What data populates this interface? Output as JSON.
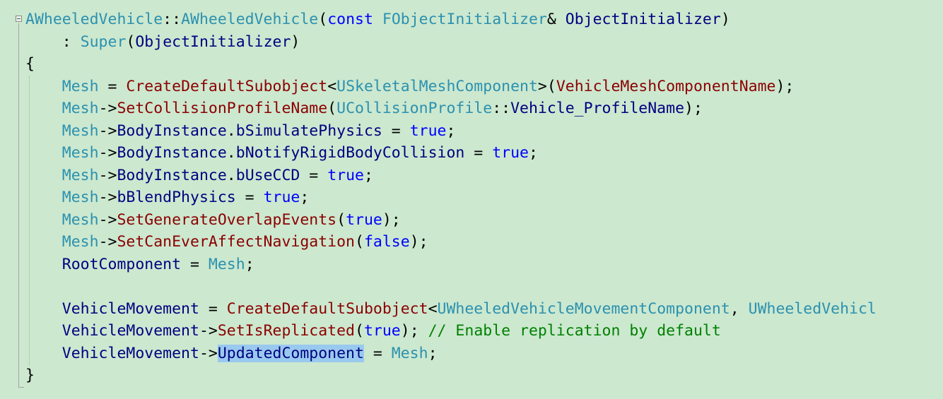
{
  "code": {
    "l1": [
      "AWheeledVehicle",
      "::",
      "AWheeledVehicle",
      "(",
      "const",
      " ",
      "FObjectInitializer",
      "& ",
      "ObjectInitializer",
      ")"
    ],
    "l2": [
      "    : ",
      "Super",
      "(",
      "ObjectInitializer",
      ")"
    ],
    "l3": [
      "{"
    ],
    "l4": [
      "    ",
      "Mesh",
      " = ",
      "CreateDefaultSubobject",
      "<",
      "USkeletalMeshComponent",
      ">(",
      "VehicleMeshComponentName",
      ");"
    ],
    "l5": [
      "    ",
      "Mesh",
      "->",
      "SetCollisionProfileName",
      "(",
      "UCollisionProfile",
      "::",
      "Vehicle_ProfileName",
      ");"
    ],
    "l6": [
      "    ",
      "Mesh",
      "->",
      "BodyInstance",
      ".",
      "bSimulatePhysics",
      " = ",
      "true",
      ";"
    ],
    "l7": [
      "    ",
      "Mesh",
      "->",
      "BodyInstance",
      ".",
      "bNotifyRigidBodyCollision",
      " = ",
      "true",
      ";"
    ],
    "l8": [
      "    ",
      "Mesh",
      "->",
      "BodyInstance",
      ".",
      "bUseCCD",
      " = ",
      "true",
      ";"
    ],
    "l9": [
      "    ",
      "Mesh",
      "->",
      "bBlendPhysics",
      " = ",
      "true",
      ";"
    ],
    "l10": [
      "    ",
      "Mesh",
      "->",
      "SetGenerateOverlapEvents",
      "(",
      "true",
      ");"
    ],
    "l11": [
      "    ",
      "Mesh",
      "->",
      "SetCanEverAffectNavigation",
      "(",
      "false",
      ");"
    ],
    "l12": [
      "    ",
      "RootComponent",
      " = ",
      "Mesh",
      ";"
    ],
    "l14": [
      "    ",
      "VehicleMovement",
      " = ",
      "CreateDefaultSubobject",
      "<",
      "UWheeledVehicleMovementComponent",
      ", ",
      "UWheeledVehicl"
    ],
    "l15": [
      "    ",
      "VehicleMovement",
      "->",
      "SetIsReplicated",
      "(",
      "true",
      "); ",
      "// Enable replication by default"
    ],
    "l16": [
      "    ",
      "VehicleMovement",
      "->",
      "UpdatedComponent",
      " = ",
      "Mesh",
      ";"
    ],
    "l17": [
      "}"
    ]
  },
  "theme": {
    "background": "#cce8cf",
    "type": "#2b91af",
    "keyword": "#0000ff",
    "function": "#8b0000",
    "member": "#000080",
    "comment": "#008000",
    "selection": "#99c9ef"
  }
}
